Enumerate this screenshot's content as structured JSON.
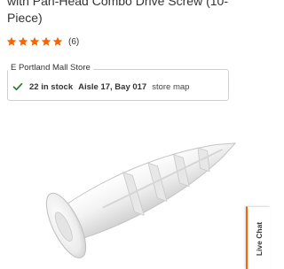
{
  "product": {
    "title": "with Pan-Head Combo Drive Screw (10-Piece)",
    "rating": 5,
    "rating_max": 5,
    "review_count": "(6)",
    "star_color": "#f96302"
  },
  "store": {
    "name": "E Portland Mall Store",
    "stock": "22 in stock",
    "aisle": "Aisle 17, Bay 017",
    "map_link": "store map",
    "check_color": "#2e7d32"
  },
  "image": {
    "icon": "plastic-wall-anchor"
  },
  "live_chat": {
    "label": "Live Chat",
    "accent_color": "#f96302"
  }
}
